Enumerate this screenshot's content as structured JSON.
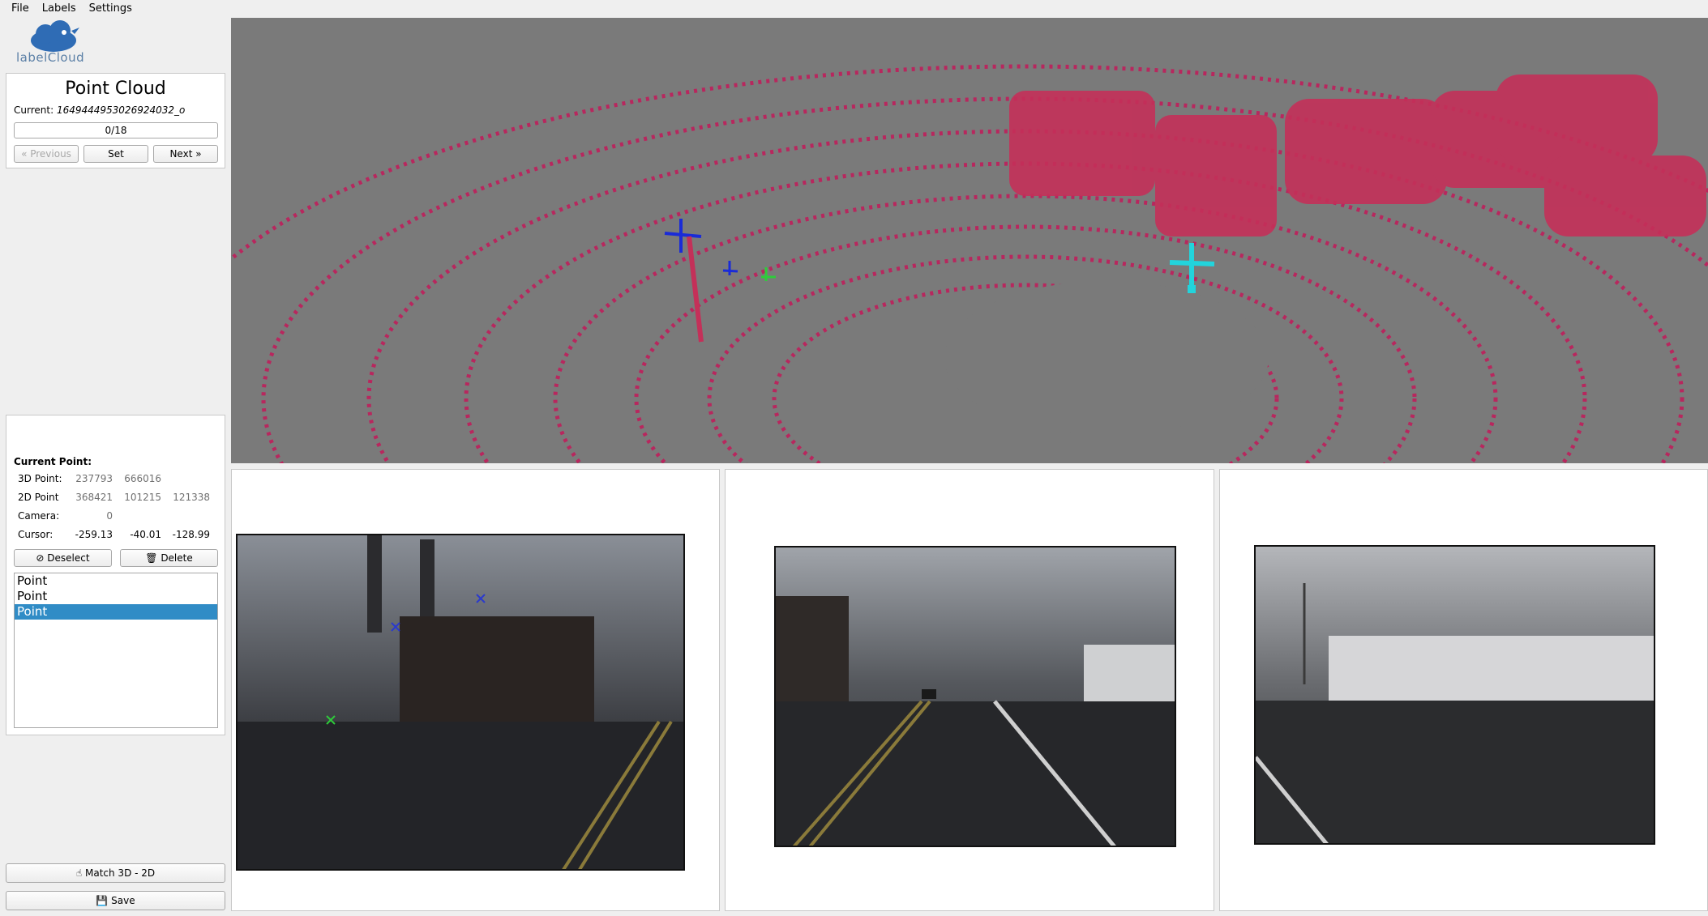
{
  "menu": [
    "File",
    "Labels",
    "Settings"
  ],
  "logo_text": "labelCloud",
  "point_cloud": {
    "title": "Point Cloud",
    "current_label": "Current:",
    "current_file": "1649444953026924032_o",
    "progress_text": "0/18",
    "previous_label": "« Previous",
    "set_label": "Set",
    "next_label": "Next »"
  },
  "current_point": {
    "title": "Current Point:",
    "point3d_label": "3D Point:",
    "point3d_values": [
      "237793",
      "666016"
    ],
    "point2d_label": "2D Point",
    "point2d_values": [
      "368421",
      "101215",
      "121338"
    ],
    "camera_label": "Camera:",
    "camera_value": "0",
    "cursor_label": "Cursor:",
    "cursor_values": [
      "-259.13",
      "-40.01",
      "-128.99"
    ]
  },
  "actions": {
    "deselect_label": "Deselect",
    "delete_label": "Delete",
    "match_label": "Match 3D - 2D",
    "save_label": "Save"
  },
  "point_list": [
    "Point",
    "Point",
    "Point"
  ],
  "selected_index": 2,
  "colors": {
    "accent": "#308cc6",
    "pointcloud": "#b8275e",
    "marker_cyan": "#22d4dc",
    "marker_blue": "#1a2bd8",
    "marker_green": "#2ecc3a"
  }
}
